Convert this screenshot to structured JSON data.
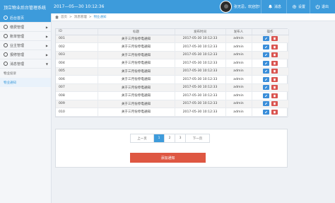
{
  "app": {
    "title": "顶立物业后台管理系统",
    "datetime": "2017—05—30  10:12:36"
  },
  "user": {
    "welcome": "张无忌，欢迎您!"
  },
  "topbar": {
    "messages": "消息",
    "settings": "设置",
    "logout": "退出"
  },
  "sidebar": {
    "items": [
      {
        "label": "后台首页",
        "icon": "home-icon"
      },
      {
        "label": "缴费管理",
        "icon": "wallet-icon"
      },
      {
        "label": "账单管理",
        "icon": "bill-icon"
      },
      {
        "label": "业主管理",
        "icon": "user-icon"
      },
      {
        "label": "报修管理",
        "icon": "wrench-icon"
      },
      {
        "label": "消息管理",
        "icon": "message-icon"
      }
    ],
    "subitems": [
      {
        "label": "物业投诉"
      },
      {
        "label": "物业通知"
      }
    ]
  },
  "breadcrumb": {
    "home": "首页",
    "sep": ">",
    "section": "消息管理",
    "current": "物业通知"
  },
  "table": {
    "headers": [
      "ID",
      "标题",
      "发布时间",
      "发布人",
      "操作"
    ],
    "rows": [
      {
        "id": "001",
        "title": "关于三月份停电通知",
        "date": "2017-05-30 10:12:33",
        "publisher": "admin"
      },
      {
        "id": "002",
        "title": "关于三月份停电通知",
        "date": "2017-05-30 10:12:33",
        "publisher": "admin"
      },
      {
        "id": "003",
        "title": "关于三月份停电通知",
        "date": "2017-05-30 10:12:33",
        "publisher": "admin"
      },
      {
        "id": "004",
        "title": "关于三月份停电通知",
        "date": "2017-05-30 10:12:33",
        "publisher": "admin"
      },
      {
        "id": "005",
        "title": "关于三月份停电通知",
        "date": "2017-05-30 10:12:33",
        "publisher": "admin"
      },
      {
        "id": "006",
        "title": "关于三月份停电通知",
        "date": "2017-05-30 10:12:33",
        "publisher": "admin"
      },
      {
        "id": "007",
        "title": "关于三月份停电通知",
        "date": "2017-05-30 10:12:33",
        "publisher": "admin"
      },
      {
        "id": "008",
        "title": "关于三月份停电通知",
        "date": "2017-05-30 10:12:33",
        "publisher": "admin"
      },
      {
        "id": "009",
        "title": "关于三月份停电通知",
        "date": "2017-05-30 10:12:33",
        "publisher": "admin"
      },
      {
        "id": "010",
        "title": "关于三月份停电通知",
        "date": "2017-05-30 10:12:33",
        "publisher": "admin"
      }
    ]
  },
  "pagination": {
    "prev": "上一页",
    "pages": [
      "1",
      "2",
      "3"
    ],
    "current": "1",
    "next": "下一页"
  },
  "actions": {
    "add": "添加通知"
  },
  "colors": {
    "primary": "#3d9bdb",
    "danger": "#de5742",
    "edit": "#3b8ed9"
  }
}
